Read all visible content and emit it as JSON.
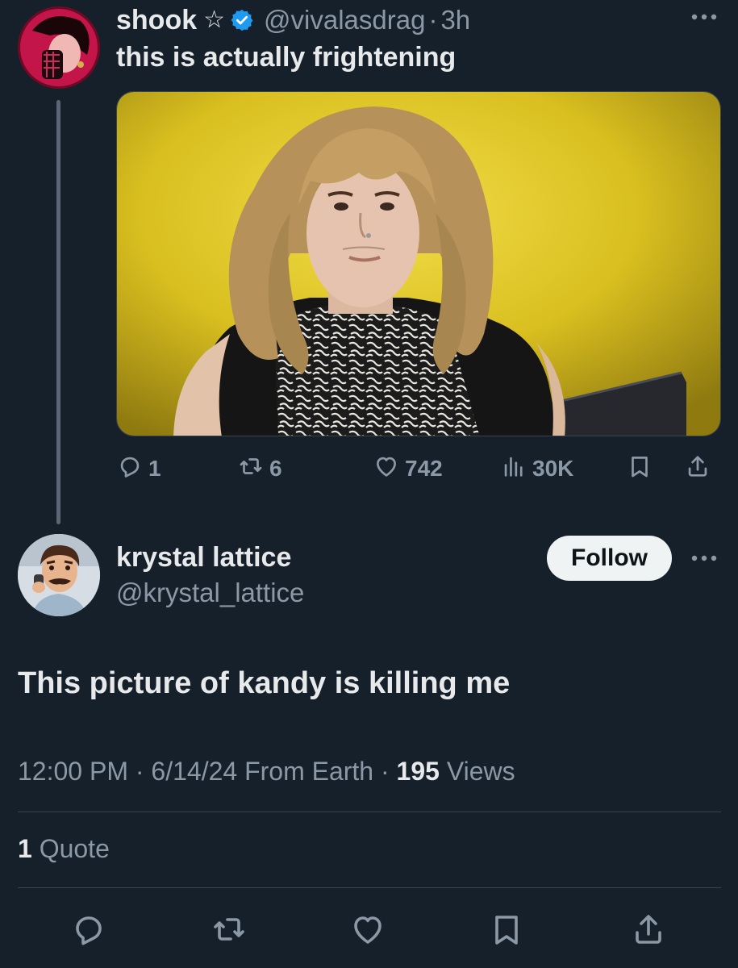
{
  "parent_tweet": {
    "display_name": "shook",
    "star_glyph": "☆",
    "verified": true,
    "handle": "@vivalasdrag",
    "separator": "·",
    "time": "3h",
    "text": "this is actually frightening",
    "media_icon": "photo-person-wig-yellow-background",
    "actions": {
      "replies": "1",
      "reposts": "6",
      "likes": "742",
      "views": "30K"
    }
  },
  "reply_tweet": {
    "display_name": "krystal lattice",
    "handle": "@krystal_lattice",
    "follow_label": "Follow",
    "text": "This picture of kandy is killing me",
    "meta": {
      "time": "12:00 PM",
      "separator": "·",
      "date_source": "6/14/24 From Earth",
      "separator2": "·",
      "views_count": "195",
      "views_label": "Views"
    },
    "quotes": {
      "count": "1",
      "label": "Quote"
    }
  },
  "colors": {
    "background": "#15202b",
    "text_primary": "#e7e9ea",
    "text_secondary": "#8b98a5",
    "verified_blue": "#1d9bf0",
    "divider": "#38444d"
  },
  "icons": [
    "reply-icon",
    "repost-icon",
    "like-icon",
    "views-icon",
    "bookmark-icon",
    "share-icon",
    "more-icon",
    "verified-icon",
    "star-icon"
  ]
}
